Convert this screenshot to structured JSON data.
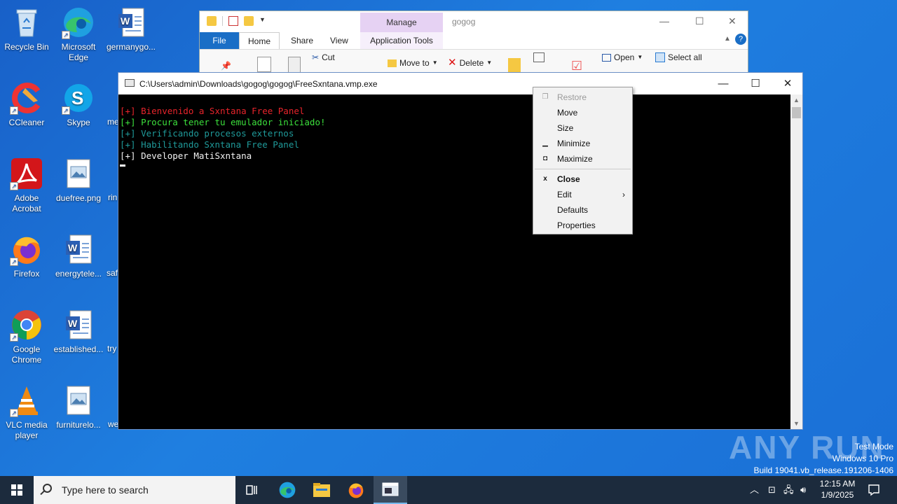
{
  "desktop": {
    "icons": [
      {
        "label": "Recycle Bin",
        "icon": "recycle-bin-icon"
      },
      {
        "label": "Microsoft Edge",
        "icon": "edge-icon"
      },
      {
        "label": "germanygo...",
        "icon": "word-doc-icon"
      },
      {
        "label": "CCleaner",
        "icon": "ccleaner-icon"
      },
      {
        "label": "Skype",
        "icon": "skype-icon"
      },
      {
        "label": "Adobe Acrobat",
        "icon": "acrobat-icon"
      },
      {
        "label": "duefree.png",
        "icon": "image-file-icon"
      },
      {
        "label": "Firefox",
        "icon": "firefox-icon"
      },
      {
        "label": "energytele...",
        "icon": "word-doc-icon"
      },
      {
        "label": "Google Chrome",
        "icon": "chrome-icon"
      },
      {
        "label": "established...",
        "icon": "word-doc-icon"
      },
      {
        "label": "VLC media player",
        "icon": "vlc-icon"
      },
      {
        "label": "furniturelo...",
        "icon": "image-file-icon"
      }
    ],
    "cut_labels": [
      "me",
      "rin",
      "saf",
      "try",
      "we"
    ]
  },
  "explorer": {
    "manage_label": "Manage",
    "title": "gogog",
    "tabs": {
      "file": "File",
      "home": "Home",
      "share": "Share",
      "view": "View",
      "app_tools": "Application Tools"
    },
    "ribbon": {
      "cut": "Cut",
      "move_to": "Move to",
      "delete": "Delete",
      "open": "Open",
      "select_all": "Select all"
    }
  },
  "console": {
    "title": "C:\\Users\\admin\\Downloads\\gogog\\gogog\\FreeSxntana.vmp.exe",
    "lines": [
      {
        "text": "[+] Bienvenido a Sxntana Free Panel",
        "color": "#e8242b"
      },
      {
        "text": "[+] Procura tener tu emulador iniciado!",
        "color": "#3ce03c"
      },
      {
        "text": "[+] Verificando procesos externos",
        "color": "#1f9a9a"
      },
      {
        "text": "[+] Habilitando Sxntana Free Panel",
        "color": "#1f9a9a"
      },
      {
        "text": "[+] Developer MatiSxntana",
        "color": "#f2f2f2"
      }
    ]
  },
  "context_menu": {
    "items": [
      {
        "label": "Restore",
        "disabled": true,
        "glyph": "restore-icon"
      },
      {
        "label": "Move",
        "disabled": false
      },
      {
        "label": "Size",
        "disabled": false
      },
      {
        "label": "Minimize",
        "disabled": false,
        "glyph": "minimize-icon"
      },
      {
        "label": "Maximize",
        "disabled": false,
        "glyph": "maximize-icon"
      },
      {
        "label": "Close",
        "bold": true,
        "glyph": "close-icon"
      },
      {
        "label": "Edit",
        "submenu": true
      },
      {
        "label": "Defaults"
      },
      {
        "label": "Properties"
      }
    ]
  },
  "watermark": {
    "brand": "ANY RUN",
    "line1": "Test Mode",
    "line2": "Windows 10 Pro",
    "line3": "Build 19041.vb_release.191206-1406"
  },
  "taskbar": {
    "search_placeholder": "Type here to search",
    "time": "12:15 AM",
    "date": "1/9/2025",
    "apps": [
      "task-view-icon",
      "edge-icon",
      "file-explorer-icon",
      "firefox-icon",
      "console-app-icon"
    ]
  },
  "colors": {
    "desktop": "#1e78d8",
    "taskbar": "#1c2b3d",
    "console_bg": "#000000"
  }
}
